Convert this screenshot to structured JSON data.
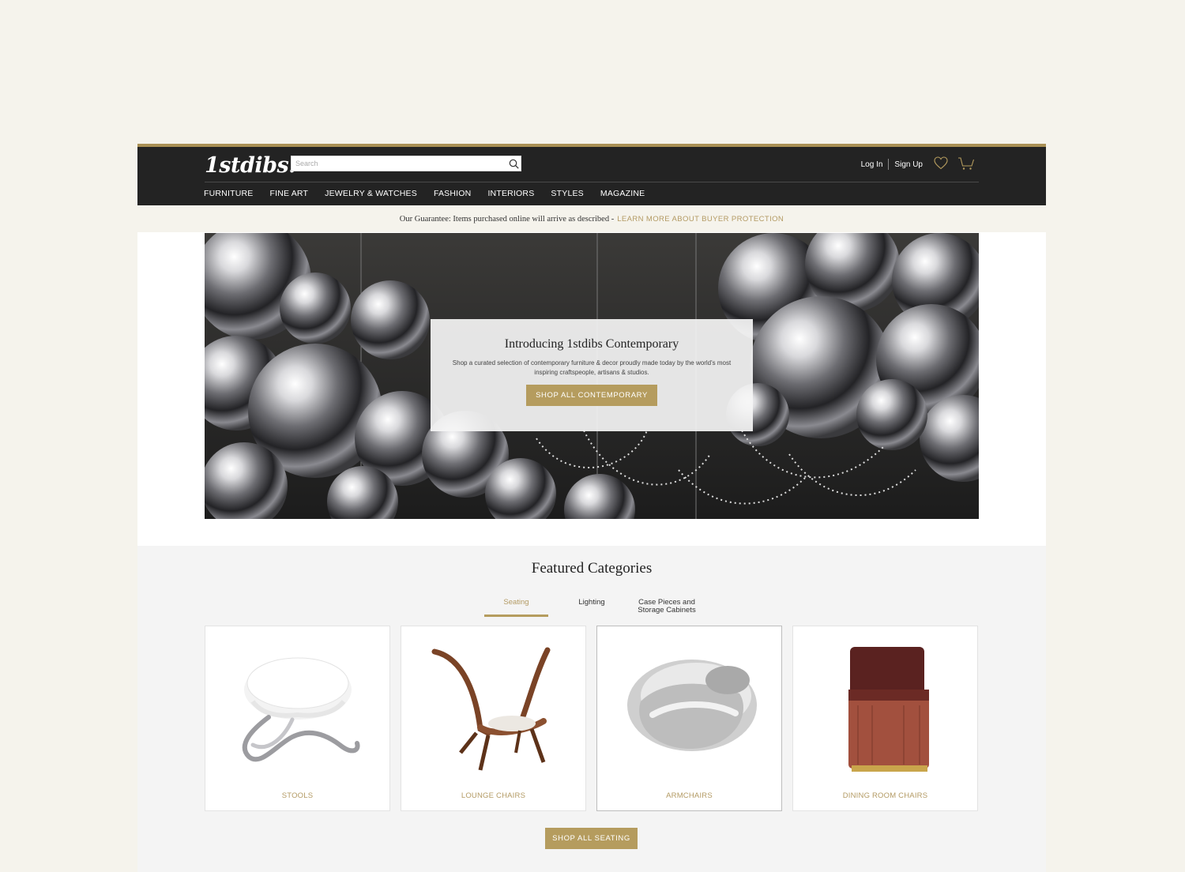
{
  "header": {
    "logo": "1stdibs.",
    "search_placeholder": "Search",
    "login": "Log In",
    "signup": "Sign Up",
    "nav": [
      "FURNITURE",
      "FINE ART",
      "JEWELRY & WATCHES",
      "FASHION",
      "INTERIORS",
      "STYLES",
      "MAGAZINE"
    ]
  },
  "guarantee": {
    "text": "Our Guarantee: Items purchased online will arrive as described -",
    "link": "LEARN MORE ABOUT BUYER PROTECTION"
  },
  "hero": {
    "title": "Introducing 1stdibs Contemporary",
    "text": "Shop a curated selection of contemporary furniture & decor proudly made today by the world's most inspiring craftspeople, artisans & studios.",
    "button": "SHOP ALL CONTEMPORARY"
  },
  "featured": {
    "title": "Featured Categories",
    "tabs": [
      "Seating",
      "Lighting",
      "Case Pieces and Storage Cabinets"
    ],
    "active_tab": "Seating",
    "cards": [
      "STOOLS",
      "LOUNGE CHAIRS",
      "ARMCHAIRS",
      "DINING ROOM CHAIRS"
    ],
    "button": "SHOP ALL SEATING"
  },
  "colors": {
    "gold": "#b59c5e",
    "header_bg": "#232323",
    "cream": "#f5f3ec"
  }
}
